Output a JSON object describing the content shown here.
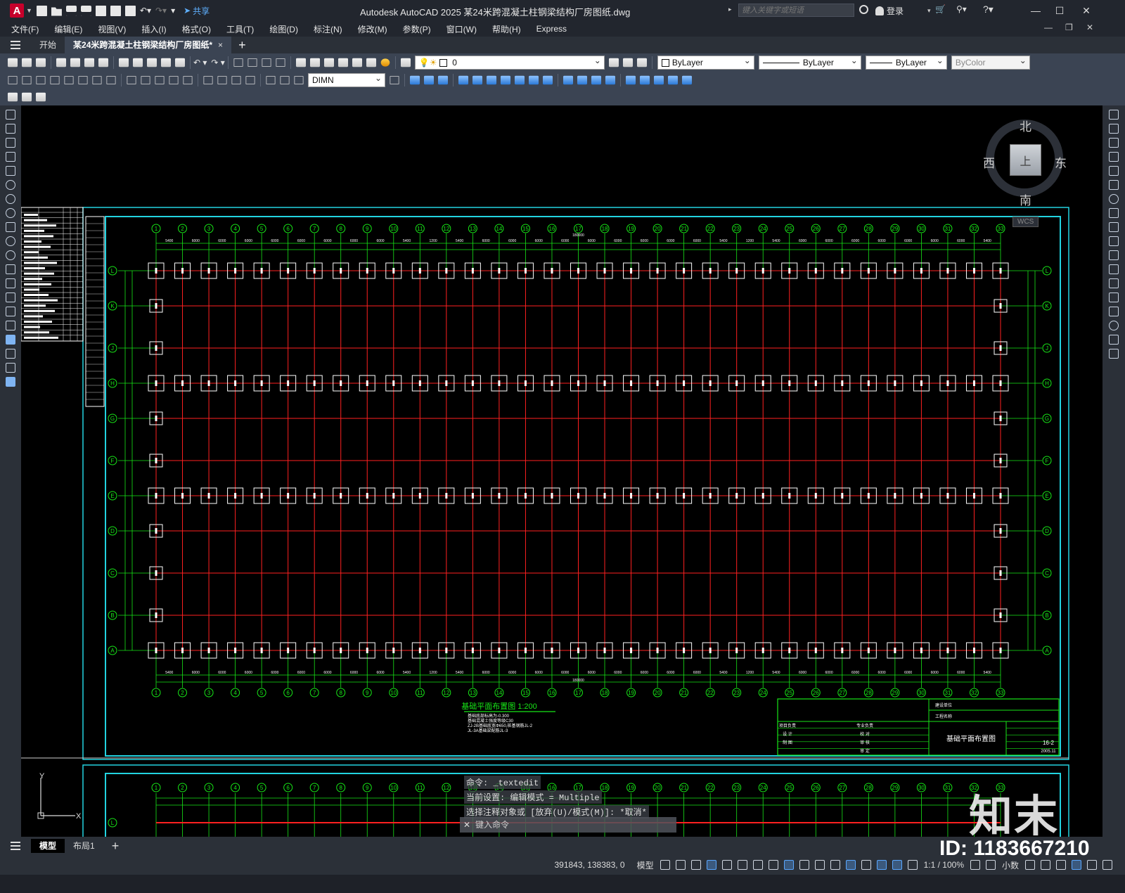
{
  "app": {
    "title": "Autodesk AutoCAD 2025    某24米跨混凝土柱钢梁结构厂房图纸.dwg",
    "icon_letter": "A",
    "share_label": "共享",
    "search_placeholder": "键入关键字或短语",
    "login_label": "登录",
    "window_buttons": [
      "—",
      "☐",
      "✕"
    ],
    "mdi_buttons": [
      "—",
      "❐",
      "✕"
    ]
  },
  "menu": [
    "文件(F)",
    "编辑(E)",
    "视图(V)",
    "插入(I)",
    "格式(O)",
    "工具(T)",
    "绘图(D)",
    "标注(N)",
    "修改(M)",
    "参数(P)",
    "窗口(W)",
    "帮助(H)",
    "Express"
  ],
  "tabs": {
    "start": "开始",
    "active": "某24米跨混凝土柱钢梁结构厂房图纸*",
    "close": "×",
    "new": "+"
  },
  "toolbar": {
    "layer_value": "0",
    "color_value": "ByLayer",
    "linetype_value": "ByLayer",
    "lineweight_value": "ByLayer",
    "plotstyle_value": "ByColor",
    "dimstyle_value": "DIMN"
  },
  "viewcube": {
    "north": "北",
    "south": "南",
    "east": "东",
    "west": "西",
    "face": "上",
    "wcs": "WCS"
  },
  "drawing": {
    "grid_numbers": [
      "1",
      "2",
      "3",
      "4",
      "5",
      "6",
      "7",
      "8",
      "9",
      "10",
      "11",
      "12",
      "13",
      "14",
      "15",
      "16",
      "17",
      "18",
      "19",
      "20",
      "21",
      "22",
      "23",
      "24",
      "25",
      "26",
      "27",
      "28",
      "29",
      "30",
      "31",
      "32",
      "33"
    ],
    "grid_letters": [
      "L",
      "K",
      "J",
      "H",
      "G",
      "F",
      "E",
      "D",
      "C",
      "B",
      "A"
    ],
    "span_dims": [
      "5400",
      "6000",
      "6000",
      "6000",
      "6000",
      "6000",
      "6000",
      "6000",
      "6000",
      "5400",
      "1200",
      "5400",
      "6000",
      "6000",
      "6000",
      "6000",
      "6000",
      "6000",
      "6000",
      "6000",
      "6000",
      "5400",
      "1200",
      "5400",
      "6000",
      "6000",
      "6000",
      "6000",
      "6000",
      "6000",
      "6000",
      "5400"
    ],
    "total_dim": "180000",
    "plan_title": "基础平面布置图",
    "plan_scale": "1:200",
    "notes": [
      "基础底部标高为-0.300",
      "基础混凝土强度等级C30",
      "ZJ-2B基础底宽Φ650,桩基钢筋JL-2",
      "JL-3A基础梁配筋JL-3"
    ],
    "title_block": {
      "company_label": "建设单位",
      "project_label": "工程名称",
      "sheet_title": "基础平面布置图",
      "drawing_no": "16-2",
      "date": "2005.11",
      "rows": [
        "项目负责",
        "设  计",
        "制  图",
        "专业负责",
        "校  对",
        "审  核",
        "审  定"
      ]
    }
  },
  "command": {
    "history": [
      "命令: _textedit",
      "当前设置: 编辑模式 = Multiple",
      "选择注释对象或 [放弃(U)/模式(M)]: *取消*"
    ],
    "prompt": "键入命令"
  },
  "layout_tabs": {
    "model": "模型",
    "layout1": "布局1",
    "add": "+"
  },
  "status": {
    "coords": "391843, 138383, 0",
    "space": "模型",
    "annotation_scale": "1:1 / 100%",
    "units": "小数"
  },
  "watermark": {
    "logo_text": "知末",
    "id_text": "ID: 1183667210"
  },
  "colors": {
    "grid_red": "#ff2020",
    "grid_green": "#17e617",
    "frame_cyan": "#22d3e0",
    "foundation_white": "#ffffff",
    "ui_dark": "#22262e",
    "ribbon": "#3b4453"
  }
}
